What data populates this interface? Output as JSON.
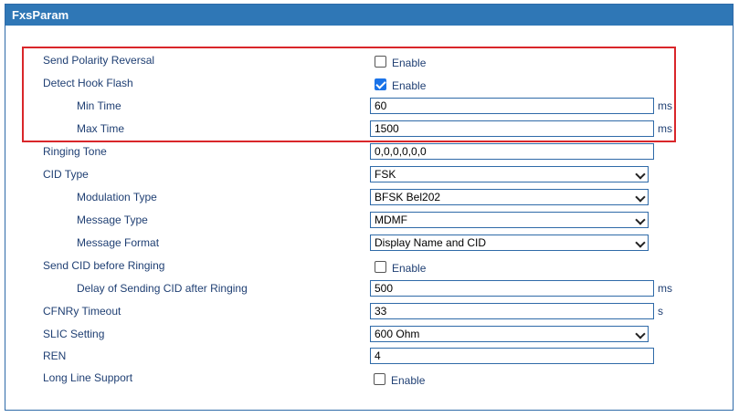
{
  "panel": {
    "title": "FxsParam"
  },
  "rows": {
    "polarity": {
      "label": "Send Polarity Reversal",
      "checkbox_label": "Enable",
      "checked": false
    },
    "hookflash": {
      "label": "Detect Hook Flash",
      "checkbox_label": "Enable",
      "checked": true
    },
    "min_time": {
      "label": "Min Time",
      "value": "60",
      "unit": "ms"
    },
    "max_time": {
      "label": "Max Time",
      "value": "1500",
      "unit": "ms"
    },
    "ringing_tone": {
      "label": "Ringing Tone",
      "value": "0,0,0,0,0,0"
    },
    "cid_type": {
      "label": "CID Type",
      "selected": "FSK"
    },
    "modulation_type": {
      "label": "Modulation Type",
      "selected": "BFSK Bel202"
    },
    "message_type": {
      "label": "Message Type",
      "selected": "MDMF"
    },
    "message_format": {
      "label": "Message Format",
      "selected": "Display Name and CID"
    },
    "send_cid": {
      "label": "Send CID before Ringing",
      "checkbox_label": "Enable",
      "checked": false
    },
    "delay_cid": {
      "label": "Delay of Sending CID after Ringing",
      "value": "500",
      "unit": "ms"
    },
    "cfnry": {
      "label": "CFNRy Timeout",
      "value": "33",
      "unit": "s"
    },
    "slic": {
      "label": "SLIC Setting",
      "selected": "600 Ohm"
    },
    "ren": {
      "label": "REN",
      "value": "4"
    },
    "long_line": {
      "label": "Long Line Support",
      "checkbox_label": "Enable",
      "checked": false
    }
  },
  "colors": {
    "header": "#2f77b6",
    "highlight": "#d9262a",
    "label": "#1f3f73"
  }
}
